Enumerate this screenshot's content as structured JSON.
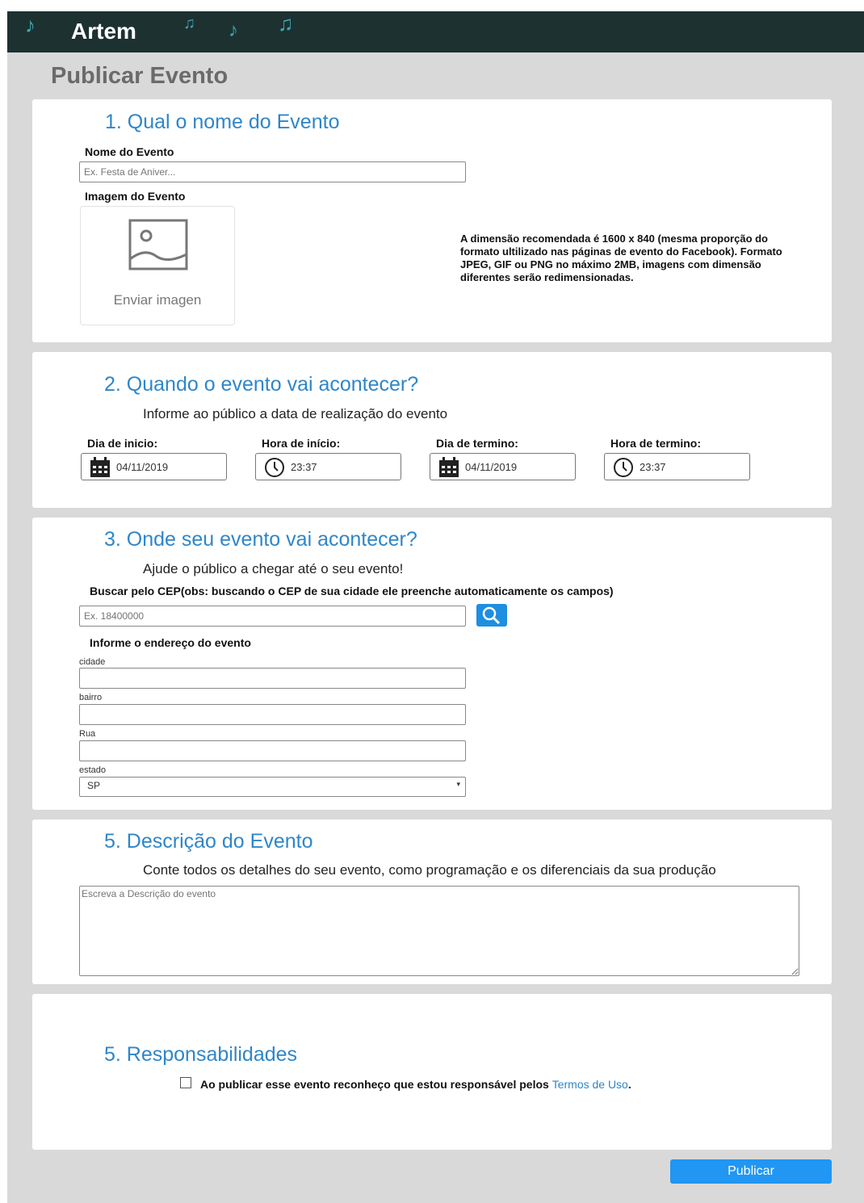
{
  "app": {
    "brand": "Artem"
  },
  "page_title": "Publicar Evento",
  "section1": {
    "title": "1. Qual o nome do Evento",
    "name_label": "Nome do Evento",
    "name_placeholder": "Ex. Festa de Aniver...",
    "image_label": "Imagem do Evento",
    "upload_label": "Enviar imagen",
    "info_text": "A dimensão recomendada é 1600 x 840 (mesma proporção do formato ultilizado nas páginas de evento do Facebook). Formato JPEG, GIF ou PNG no máximo 2MB, imagens com dimensão diferentes serão redimensionadas."
  },
  "section2": {
    "title": "2. Quando o evento vai acontecer?",
    "subtitle": "Informe ao público a data de realização do evento",
    "start_date_label": "Dia de inicio:",
    "start_date_value": "04/11/2019",
    "start_time_label": "Hora de início:",
    "start_time_value": "23:37",
    "end_date_label": "Dia de termino:",
    "end_date_value": "04/11/2019",
    "end_time_label": "Hora de termino:",
    "end_time_value": "23:37"
  },
  "section3": {
    "title": "3. Onde seu evento vai acontecer?",
    "subtitle": "Ajude o público a chegar até o seu evento!",
    "cep_label": "Buscar pelo CEP(obs: buscando o CEP de sua cidade ele preenche automaticamente os campos)",
    "cep_placeholder": "Ex. 18400000",
    "address_label": "Informe o endereço do evento",
    "city_label": "cidade",
    "district_label": "bairro",
    "street_label": "Rua",
    "state_label": "estado",
    "state_value": "SP"
  },
  "section4": {
    "title": "5. Descrição do Evento",
    "subtitle": "Conte todos os detalhes do seu evento, como programação e os diferenciais da sua produção",
    "description_placeholder": "Escreva a Descrição do evento"
  },
  "section5": {
    "title": "5. Responsabilidades",
    "terms_text": "Ao publicar esse evento reconheço que estou responsável pelos",
    "terms_link": "Termos de Uso",
    "terms_end": "."
  },
  "publish_label": "Publicar",
  "colors": {
    "header_bg": "#1d3131",
    "accent": "#2f86c8",
    "button": "#2196f3",
    "page_bg": "#d9d9d9"
  }
}
